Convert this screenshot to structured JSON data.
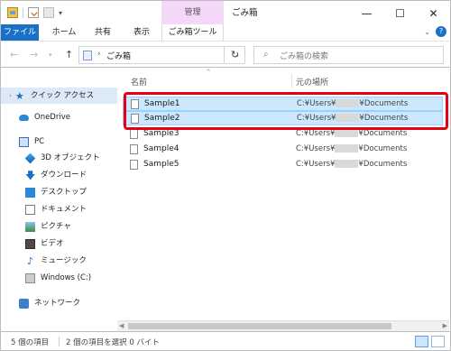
{
  "titlebar": {
    "manage_tab": "管理",
    "title": "ごみ箱",
    "buttons": [
      "—",
      "☐",
      "✕"
    ]
  },
  "ribbon": {
    "tabs": [
      "ファイル",
      "ホーム",
      "共有",
      "表示",
      "ごみ箱ツール"
    ],
    "collapse": "⌄",
    "help": "?"
  },
  "address": {
    "back": "←",
    "forward": "→",
    "up": "↑",
    "chevron": "›",
    "path": "ごみ箱",
    "refresh": "↻",
    "search_placeholder": "ごみ箱の検索"
  },
  "nav": {
    "quick_access": "クイック アクセス",
    "onedrive": "OneDrive",
    "pc": "PC",
    "items": [
      "3D オブジェクト",
      "ダウンロード",
      "デスクトップ",
      "ドキュメント",
      "ピクチャ",
      "ビデオ",
      "ミュージック",
      "Windows (C:)"
    ],
    "network": "ネットワーク"
  },
  "filelist": {
    "headers": {
      "name": "名前",
      "original_location": "元の場所"
    },
    "rows": [
      {
        "name": "Sample1",
        "path_prefix": "C:¥Users¥",
        "path_suffix": "¥Documents",
        "selected": true
      },
      {
        "name": "Sample2",
        "path_prefix": "C:¥Users¥",
        "path_suffix": "¥Documents",
        "selected": true
      },
      {
        "name": "Sample3",
        "path_prefix": "C:¥Users¥",
        "path_suffix": "¥Documents",
        "selected": false
      },
      {
        "name": "Sample4",
        "path_prefix": "C:¥Users¥",
        "path_suffix": "¥Documents",
        "selected": false
      },
      {
        "name": "Sample5",
        "path_prefix": "C:¥Users¥",
        "path_suffix": "¥Documents",
        "selected": false
      }
    ]
  },
  "status": {
    "count": "5 個の項目",
    "selection": "2 個の項目を選択  0 バイト"
  },
  "colors": {
    "accent": "#1a6fc6",
    "selection": "#cce8ff",
    "highlight": "#e50012",
    "manage_tab": "#f3d9f7"
  }
}
